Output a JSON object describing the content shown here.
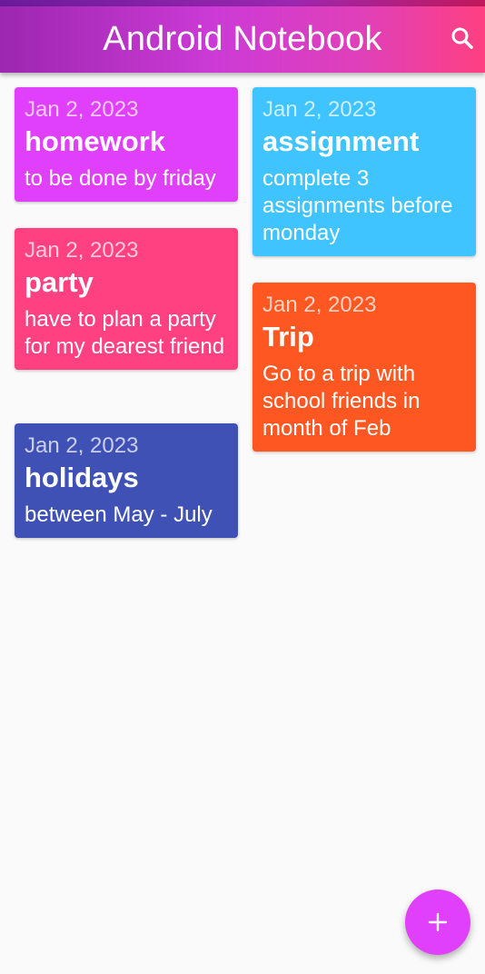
{
  "header": {
    "title": "Android Notebook",
    "search_icon": "search-icon",
    "gradient_colors": [
      "#9c27b0",
      "#e040b8",
      "#ff4081"
    ]
  },
  "notes": [
    {
      "date": "Jan 2, 2023",
      "title": "homework",
      "body": "to be done by friday",
      "color": "#e040fb"
    },
    {
      "date": "Jan 2, 2023",
      "title": "party",
      "body": "have to plan a party for my dearest friend",
      "color": "#ff4081"
    },
    {
      "date": "Jan 2, 2023",
      "title": "holidays",
      "body": "between May - July",
      "color": "#3f51b5"
    },
    {
      "date": "Jan 2, 2023",
      "title": "assignment",
      "body": "complete 3 assignments before monday",
      "color": "#40c4ff"
    },
    {
      "date": "Jan 2, 2023",
      "title": "Trip",
      "body": "Go to a trip with school friends in month of Feb",
      "color": "#ff5722"
    }
  ],
  "fab": {
    "icon": "plus-icon",
    "color": "#e040fb"
  }
}
